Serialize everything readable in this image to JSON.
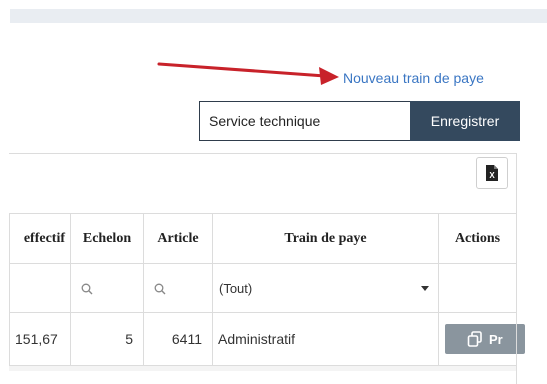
{
  "header": {
    "new_link_label": "Nouveau train de paye"
  },
  "save_form": {
    "input_value": "Service technique",
    "save_label": "Enregistrer"
  },
  "table": {
    "columns": [
      "effectif",
      "Echelon",
      "Article",
      "Train de paye",
      "Actions"
    ],
    "filter_select_value": "(Tout)",
    "rows": [
      {
        "effectif": "151,67",
        "echelon": "5",
        "article": "6411",
        "train": "Administratif",
        "action_label": "Pr"
      }
    ]
  },
  "colors": {
    "link": "#3a76c3",
    "save_button": "#34495e",
    "action_button": "#8a959e",
    "arrow": "#c8222a"
  }
}
